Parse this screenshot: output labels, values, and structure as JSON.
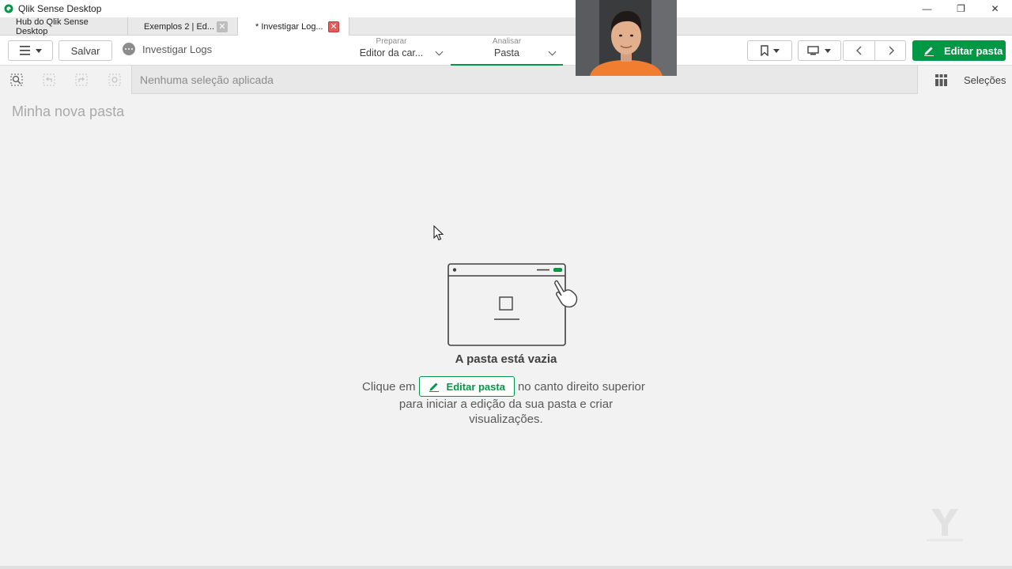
{
  "window": {
    "title": "Qlik Sense Desktop",
    "controls": [
      "—",
      "❐",
      "✕"
    ]
  },
  "tabs": [
    {
      "label": "Hub do Qlik Sense Desktop",
      "active": false
    },
    {
      "label": "Exemplos 2 | Ed...",
      "active": false,
      "close": "✕"
    },
    {
      "label": "* Investigar Log...",
      "active": true,
      "close": "✕"
    }
  ],
  "toolbar": {
    "save_label": "Salvar",
    "app_name": "Investigar Logs",
    "modes": [
      {
        "small": "Preparar",
        "big": "Editor da car...",
        "active": false
      },
      {
        "small": "Analisar",
        "big": "Pasta",
        "active": true
      }
    ],
    "edit_label": "Editar pasta",
    "accent": "#009845"
  },
  "selections": {
    "placeholder": "Nenhuma seleção aplicada",
    "label": "Seleções"
  },
  "sheet": {
    "title": "Minha nova pasta"
  },
  "empty_state": {
    "title": "A pasta está vazia",
    "prefix": "Clique em",
    "button": "Editar pasta",
    "suffix": "no canto direito superior",
    "line2": "para iniciar a edição da sua pasta e criar",
    "line3": "visualizações."
  }
}
